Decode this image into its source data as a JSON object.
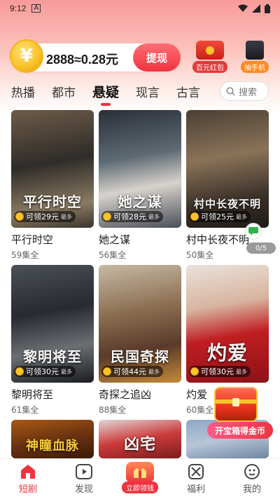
{
  "status_bar": {
    "time": "9:12",
    "notification_icon": "A"
  },
  "coin_bar": {
    "coin_symbol": "¥",
    "balance_text": "2888≈0.28元",
    "withdraw_label": "提现"
  },
  "promos": [
    {
      "label": "百元红包",
      "icon": "red-envelope-icon"
    },
    {
      "label": "抽手机",
      "icon": "phone-icon"
    }
  ],
  "tabs": [
    "热播",
    "都市",
    "悬疑",
    "现言",
    "古言"
  ],
  "active_tab_index": 2,
  "search": {
    "placeholder": "搜索"
  },
  "dramas": [
    {
      "name": "平行时空",
      "episodes": "59集全",
      "reward": "可领29元",
      "max": "最多",
      "title_art": "平行时空"
    },
    {
      "name": "她之谋",
      "episodes": "56集全",
      "reward": "可领28元",
      "max": "最多",
      "title_art": "她之谋"
    },
    {
      "name": "村中长夜不明",
      "episodes": "50集全",
      "reward": "可领25元",
      "max": "最多",
      "title_art": "村中长夜不明"
    },
    {
      "name": "黎明将至",
      "episodes": "61集全",
      "reward": "可领30元",
      "max": "最多",
      "title_art": "黎明将至"
    },
    {
      "name": "奇探之追凶",
      "episodes": "88集全",
      "reward": "可领44元",
      "max": "最多",
      "title_art": "民国奇探"
    },
    {
      "name": "灼爱",
      "episodes": "60集全",
      "reward": "可领30元",
      "max": "最多",
      "title_art": "灼爱"
    },
    {
      "name": "",
      "episodes": "",
      "reward": "",
      "max": "",
      "title_art": "神瞳血脉"
    },
    {
      "name": "",
      "episodes": "",
      "reward": "",
      "max": "",
      "title_art": "凶宅"
    },
    {
      "name": "",
      "episodes": "",
      "reward": "",
      "max": "",
      "title_art": ""
    }
  ],
  "floating": {
    "progress": "0/5",
    "treasure_label": "开宝箱得金币"
  },
  "bottom_nav": [
    {
      "label": "短剧",
      "icon": "home-icon",
      "active": true
    },
    {
      "label": "发现",
      "icon": "play-icon",
      "active": false
    },
    {
      "label": "立即领钱",
      "icon": "gift-box-icon",
      "active": false
    },
    {
      "label": "福利",
      "icon": "welfare-icon",
      "active": false
    },
    {
      "label": "我的",
      "icon": "profile-icon",
      "active": false
    }
  ],
  "colors": {
    "accent": "#f0333f",
    "coin": "#f8c42a"
  }
}
